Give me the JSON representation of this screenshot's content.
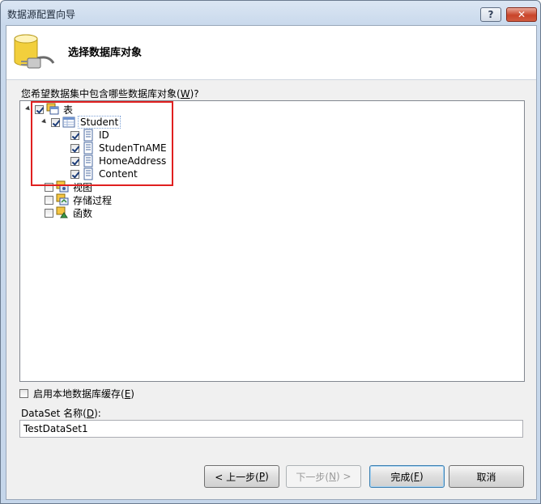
{
  "window": {
    "title": "数据源配置向导",
    "help_label": "?",
    "close_label": "✕"
  },
  "header": {
    "title": "选择数据库对象",
    "icon": "database-plug-icon"
  },
  "tree": {
    "prompt_text": "您希望数据集中包含哪些数据库对象(",
    "prompt_key": "W",
    "prompt_tail": ")?",
    "nodes": [
      {
        "label": "表",
        "checked": true,
        "expanded": true,
        "icon": "tables-icon"
      },
      {
        "label": "Student",
        "checked": true,
        "expanded": true,
        "icon": "table-icon"
      },
      {
        "label": "ID",
        "checked": true,
        "icon": "column-icon"
      },
      {
        "label": "StudenTnAME",
        "checked": true,
        "icon": "column-icon"
      },
      {
        "label": "HomeAddress",
        "checked": true,
        "icon": "column-icon"
      },
      {
        "label": "Content",
        "checked": true,
        "icon": "column-icon"
      },
      {
        "label": "视图",
        "checked": false,
        "icon": "views-icon"
      },
      {
        "label": "存储过程",
        "checked": false,
        "icon": "stored-procedures-icon"
      },
      {
        "label": "函数",
        "checked": false,
        "icon": "functions-icon"
      }
    ]
  },
  "cache": {
    "label_text": "启用本地数据库缓存(",
    "label_key": "E",
    "label_tail": ")",
    "checked": false
  },
  "dataset": {
    "label_text": "DataSet 名称(",
    "label_key": "D",
    "label_tail": "):",
    "value": "TestDataSet1"
  },
  "buttons": {
    "prev": {
      "prefix": "< 上一步(",
      "key": "P",
      "suffix": ")"
    },
    "next": {
      "prefix": "下一步(",
      "key": "N",
      "suffix": ") >"
    },
    "finish": {
      "prefix": "完成(",
      "key": "F",
      "suffix": ")"
    },
    "cancel": {
      "label": "取消"
    }
  },
  "colors": {
    "highlight_box": "#e02020",
    "check_mark": "#1c3c78"
  }
}
